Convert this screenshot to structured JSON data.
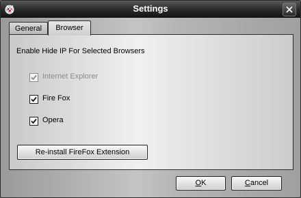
{
  "window": {
    "title": "Settings",
    "icon": "app-logo-icon",
    "close_icon": "close-icon"
  },
  "tabs": [
    {
      "label": "General",
      "active": false
    },
    {
      "label": "Browser",
      "active": true
    }
  ],
  "browser_tab": {
    "heading": "Enable Hide IP For Selected Browsers",
    "browsers": [
      {
        "label": "Internet Explorer",
        "checked": true,
        "disabled": true
      },
      {
        "label": "Fire Fox",
        "checked": true,
        "disabled": false
      },
      {
        "label": "Opera",
        "checked": true,
        "disabled": false
      }
    ],
    "reinstall_label": "Re-install FireFox Extension"
  },
  "footer": {
    "ok_mnemonic": "O",
    "ok_rest": "K",
    "cancel_mnemonic": "C",
    "cancel_rest": "ancel"
  },
  "colors": {
    "title_text": "#ffffff",
    "disabled_text": "#8c8c8c"
  }
}
